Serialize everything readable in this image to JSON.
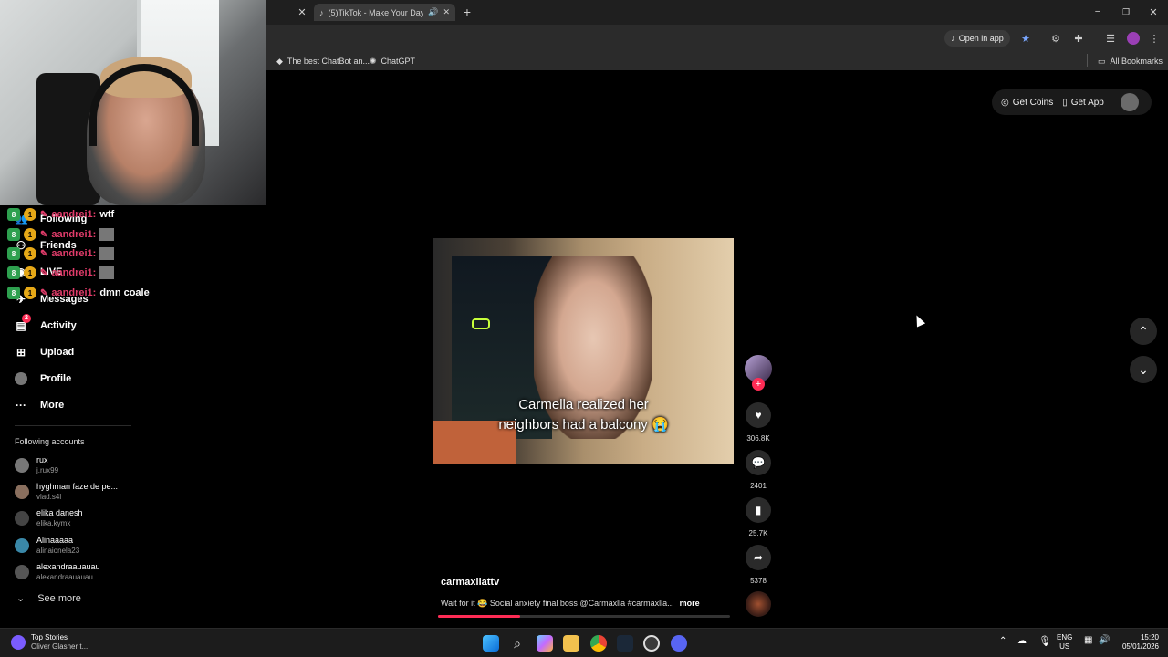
{
  "browser": {
    "tabs": [
      {
        "label": "(5)TikTok - Make Your Day",
        "active": true
      }
    ],
    "open_in_app": "Open in app",
    "bookmarks": [
      {
        "label": "The best ChatBot an..."
      },
      {
        "label": "ChatGPT"
      }
    ],
    "all_bookmarks": "All Bookmarks"
  },
  "tiktok": {
    "header": {
      "get_coins": "Get Coins",
      "get_app": "Get App"
    },
    "nav": [
      {
        "label": "Following",
        "icon": "users-icon"
      },
      {
        "label": "Friends",
        "icon": "friends-icon"
      },
      {
        "label": "LIVE",
        "icon": "live-icon"
      },
      {
        "label": "Messages",
        "icon": "messages-icon"
      },
      {
        "label": "Activity",
        "icon": "activity-icon",
        "badge": "2"
      },
      {
        "label": "Upload",
        "icon": "upload-icon"
      },
      {
        "label": "Profile",
        "icon": "profile-icon"
      },
      {
        "label": "More",
        "icon": "more-icon"
      }
    ],
    "following_title": "Following accounts",
    "accounts": [
      {
        "name": "rux",
        "handle": "j.rux99"
      },
      {
        "name": "hyghman faze de pe...",
        "handle": "vlad.s4l"
      },
      {
        "name": "elika danesh",
        "handle": "elika.kymx"
      },
      {
        "name": "Alinaaaaa",
        "handle": "alinaionela23"
      },
      {
        "name": "alexandraauauau",
        "handle": "alexandraauauau"
      }
    ],
    "see_more": "See more",
    "video": {
      "caption_line1": "Carmella realized her",
      "caption_line2": "neighbors had a balcony 😭",
      "author": "carmaxllattv",
      "description": "Wait for it 😂 Social anxiety final boss @Carmaxlla #carmaxlla...",
      "more": "more"
    },
    "actions": {
      "likes": "306.8K",
      "comments": "2401",
      "saves": "25.7K",
      "shares": "5378"
    }
  },
  "chat": [
    {
      "user": "aandrei1:",
      "message": "wtf"
    },
    {
      "user": "aandrei1:",
      "message": ""
    },
    {
      "user": "aandrei1:",
      "message": ""
    },
    {
      "user": "aandrei1:",
      "message": ""
    },
    {
      "user": "aandrei1:",
      "message": "dmn coale"
    }
  ],
  "taskbar": {
    "news_title": "Top Stories",
    "news_sub": "Oliver Glasner t...",
    "lang_top": "ENG",
    "lang_bottom": "US",
    "time": "15:20",
    "date": "05/01/2026"
  },
  "colors": {
    "tiktok_red": "#fe2c55",
    "chat_name": "#e03c6a",
    "badge_green": "#2ea04f",
    "badge_yellow": "#e6a817"
  }
}
